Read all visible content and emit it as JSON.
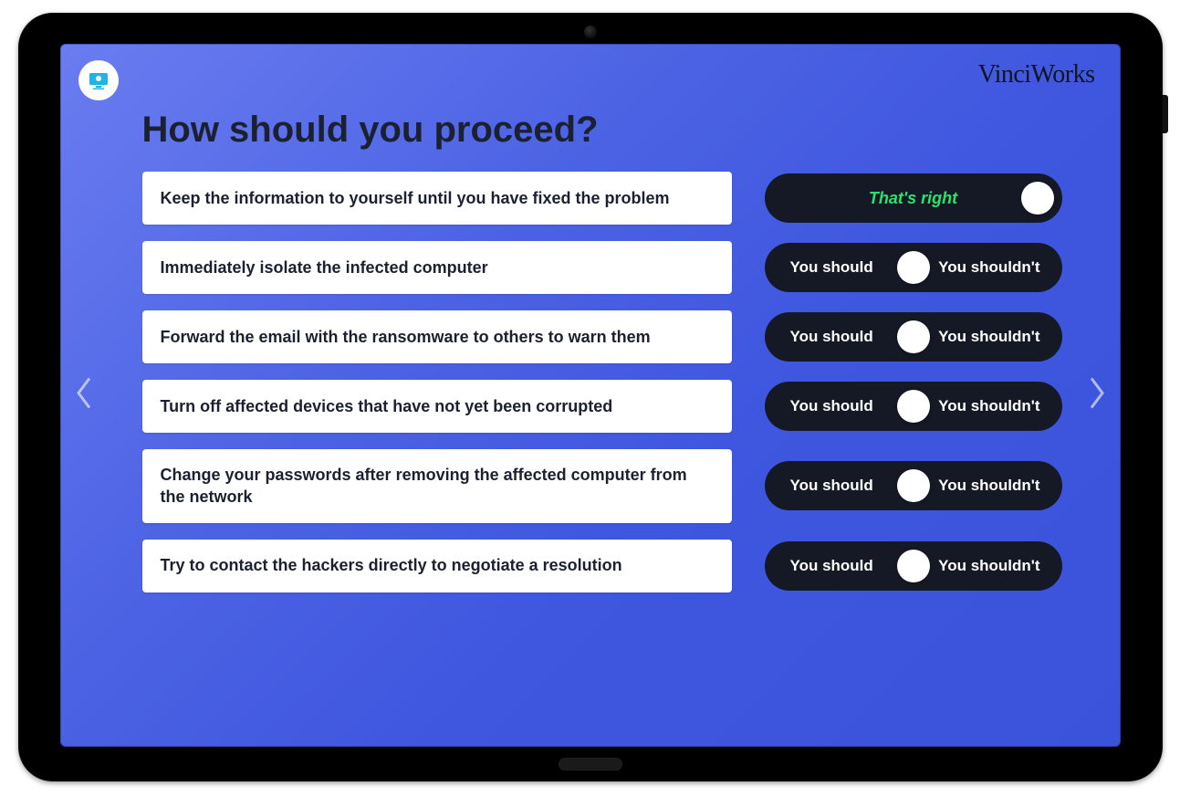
{
  "brand": "VinciWorks",
  "title": "How should you proceed?",
  "toggle_labels": {
    "left": "You should",
    "right": "You shouldn't"
  },
  "feedback_correct": "That's right",
  "rows": [
    {
      "text": "Keep the information to yourself until you have fixed the problem",
      "state": "correct"
    },
    {
      "text": "Immediately isolate the infected computer",
      "state": "neutral"
    },
    {
      "text": "Forward the email with the ransomware to others to warn them",
      "state": "neutral"
    },
    {
      "text": "Turn off affected devices that have not yet been corrupted",
      "state": "neutral"
    },
    {
      "text": "Change your passwords after removing the affected computer from the network",
      "state": "neutral"
    },
    {
      "text": "Try to contact the hackers directly to negotiate a resolution",
      "state": "neutral"
    }
  ]
}
